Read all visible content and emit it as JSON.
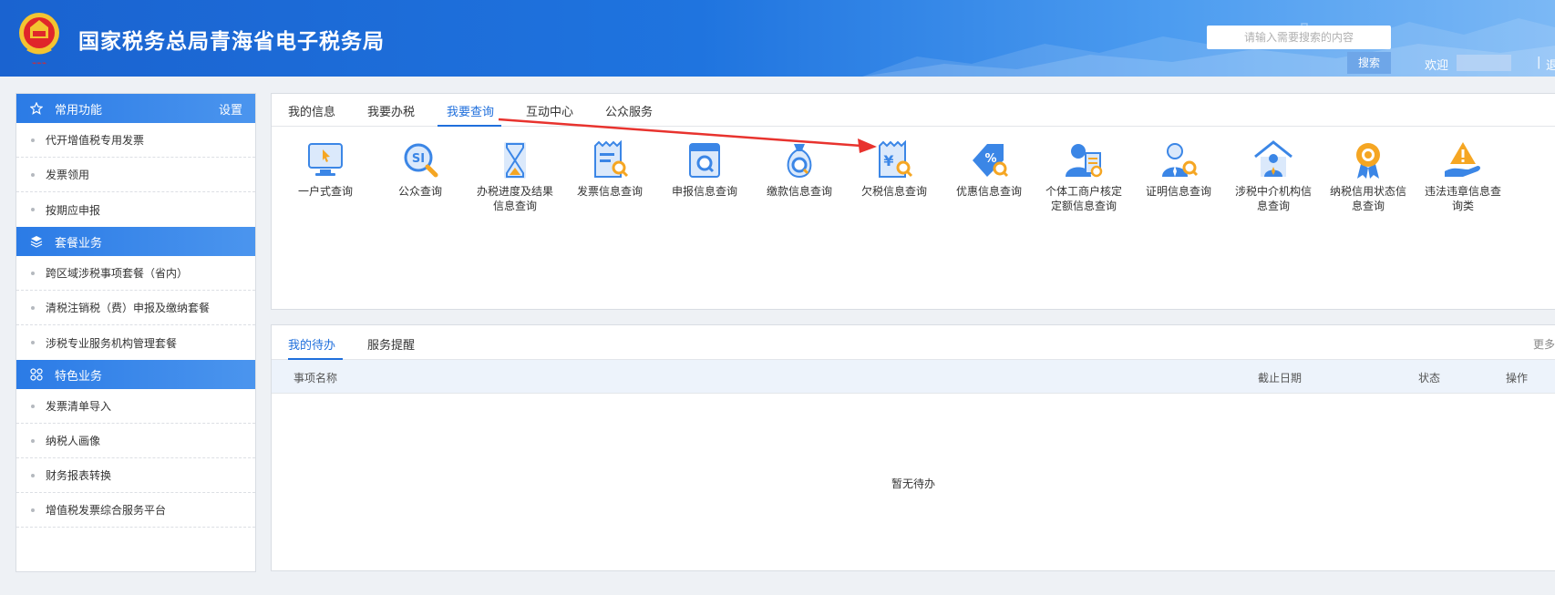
{
  "header": {
    "title": "国家税务总局青海省电子税务局",
    "search_placeholder": "请输入需要搜索的内容",
    "search_button": "搜索",
    "welcome": "欢迎",
    "separator": "|",
    "logout_partial": "退"
  },
  "sidebar": {
    "sections": [
      {
        "title": "常用功能",
        "icon": "star-icon",
        "action": "设置",
        "items": [
          "代开增值税专用发票",
          "发票领用",
          "按期应申报"
        ]
      },
      {
        "title": "套餐业务",
        "icon": "layers-icon",
        "items": [
          "跨区域涉税事项套餐（省内）",
          "清税注销税（费）申报及缴纳套餐",
          "涉税专业服务机构管理套餐"
        ]
      },
      {
        "title": "特色业务",
        "icon": "grid-icon",
        "items": [
          "发票清单导入",
          "纳税人画像",
          "财务报表转换",
          "增值税发票综合服务平台"
        ]
      }
    ]
  },
  "tabs": [
    "我的信息",
    "我要办税",
    "我要查询",
    "互动中心",
    "公众服务"
  ],
  "active_tab": "我要查询",
  "query_items": [
    {
      "icon": "monitor-cursor-icon",
      "line1": "一户式查询",
      "line2": ""
    },
    {
      "icon": "magnifier-si-icon",
      "line1": "公众查询",
      "line2": ""
    },
    {
      "icon": "hourglass-icon",
      "line1": "办税进度及结果",
      "line2": "信息查询"
    },
    {
      "icon": "invoice-search-icon",
      "line1": "发票信息查询",
      "line2": ""
    },
    {
      "icon": "declaration-search-icon",
      "line1": "申报信息查询",
      "line2": ""
    },
    {
      "icon": "money-bag-icon",
      "line1": "缴款信息查询",
      "line2": ""
    },
    {
      "icon": "yuan-receipt-search-icon",
      "line1": "欠税信息查询",
      "line2": ""
    },
    {
      "icon": "discount-tag-icon",
      "line1": "优惠信息查询",
      "line2": ""
    },
    {
      "icon": "person-doc-icon",
      "line1": "个体工商户核定",
      "line2": "定额信息查询"
    },
    {
      "icon": "certificate-person-icon",
      "line1": "证明信息查询",
      "line2": ""
    },
    {
      "icon": "agency-house-icon",
      "line1": "涉税中介机构信",
      "line2": "息查询"
    },
    {
      "icon": "credit-medal-icon",
      "line1": "纳税信用状态信",
      "line2": "息查询"
    },
    {
      "icon": "warning-hand-icon",
      "line1": "违法违章信息查",
      "line2": "询类"
    }
  ],
  "todo": {
    "tabs": [
      "我的待办",
      "服务提醒"
    ],
    "more": "更多",
    "columns": [
      "事项名称",
      "截止日期",
      "状态",
      "操作"
    ],
    "empty": "暂无待办"
  },
  "colors": {
    "brand": "#1f6fdc",
    "arrow": "#e8332e",
    "icon_orange": "#f5a623"
  }
}
